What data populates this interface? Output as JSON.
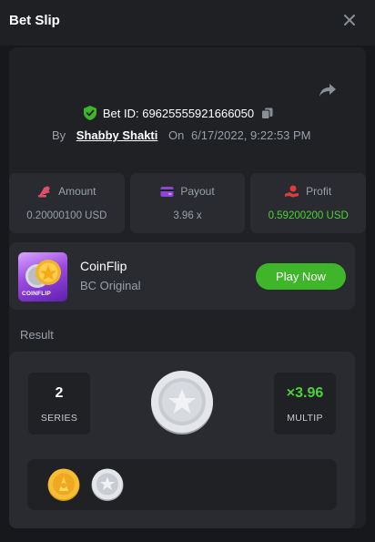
{
  "header": {
    "title": "Bet Slip"
  },
  "bet": {
    "id_label": "Bet ID: 69625555921666050",
    "by_label": "By",
    "user": "Shabby Shakti",
    "on_label": "On",
    "datetime": "6/17/2022, 9:22:53 PM"
  },
  "stats": [
    {
      "icon": "amount-icon",
      "label": "Amount",
      "value": "0.20000100 USD",
      "color": "#9aa0a9"
    },
    {
      "icon": "payout-icon",
      "label": "Payout",
      "value": "3.96 x",
      "color": "#9aa0a9"
    },
    {
      "icon": "profit-icon",
      "label": "Profit",
      "value": "0.59200200 USD",
      "color": "#4cd337"
    }
  ],
  "game": {
    "thumb_tag": "COINFLIP",
    "name": "CoinFlip",
    "subtitle": "BC Original",
    "play_label": "Play Now"
  },
  "result": {
    "label": "Result",
    "series_value": "2",
    "series_caption": "SERIES",
    "multiplier_value": "×3.96",
    "multiplier_caption": "MULTIP",
    "history": [
      "gold-coin",
      "silver-coin"
    ]
  },
  "colors": {
    "accent_green": "#3fb529",
    "profit_green": "#4cd337",
    "amount_pink": "#e0506b",
    "payout_purple": "#8e44d8",
    "profit_red": "#e23b3b"
  }
}
